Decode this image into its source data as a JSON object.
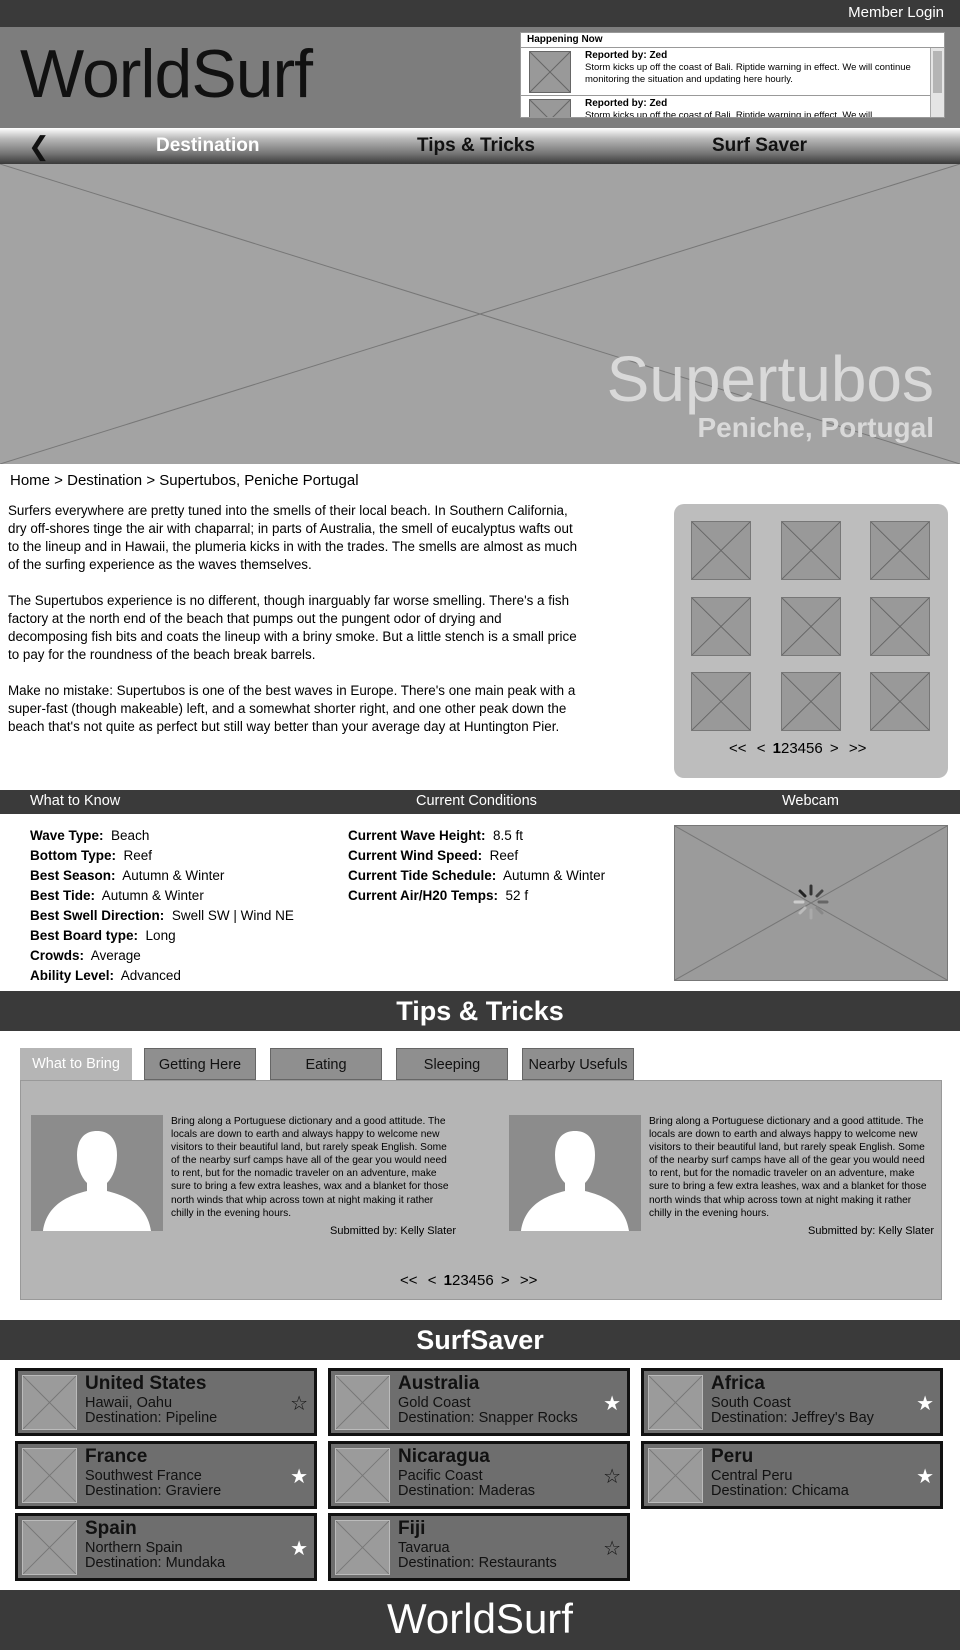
{
  "top_bar": {
    "member_login": "Member Login"
  },
  "header": {
    "logo": "WorldSurf",
    "happening_now": {
      "title": "Happening Now",
      "items": [
        {
          "reporter": "Reported by: Zed",
          "text": "Storm kicks up off the coast of Bali.  Riptide warning in effect. We will continue monitoring the situation and updating here hourly."
        },
        {
          "reporter": "Reported by: Zed",
          "text": "Storm kicks up off the coast of Bali.  Riptide warning in effect. We will"
        }
      ]
    }
  },
  "nav": {
    "back_icon": "chevron-left-icon",
    "items": [
      "Destination",
      "Tips & Tricks",
      "Surf Saver"
    ]
  },
  "hero": {
    "title": "Supertubos",
    "subtitle": "Peniche, Portugal"
  },
  "breadcrumb": "Home > Destination > Supertubos, Peniche Portugal",
  "intro": {
    "paragraphs": [
      "Surfers everywhere are pretty tuned into the smells of their local beach.  In Southern California, dry off-shores tinge the air with chaparral; in parts of Australia, the smell of eucalyptus wafts out to the lineup and in Hawaii, the plumeria kicks in with the trades. The smells are almost as much of the surfing experience as the waves themselves.",
      "The Supertubos experience is no different, though inarguably far worse smelling. There's a fish factory at the north end of the beach that pumps out the pungent odor of drying and decomposing fish bits and coats the lineup with a briny smoke. But a little stench is a small price to pay for the roundness of the beach break barrels.",
      "Make no mistake: Supertubos is one of the best waves in Europe. There's one main peak with a super-fast (though makeable) left, and a somewhat shorter right, and one other peak down the beach that's not quite as perfect but still way better than your average day at Huntington Pier."
    ]
  },
  "gallery_pager": {
    "first": "<<",
    "prev": "<",
    "pages": [
      "1",
      "2",
      "3",
      "4",
      "5",
      "6"
    ],
    "current": "1",
    "next": ">",
    "last": ">>"
  },
  "info_bar": {
    "what_to_know": "What to Know",
    "current_conditions": "Current Conditions",
    "webcam": "Webcam"
  },
  "what_to_know": [
    {
      "label": "Wave Type:",
      "value": "Beach"
    },
    {
      "label": "Bottom Type:",
      "value": "Reef"
    },
    {
      "label": "Best Season:",
      "value": "Autumn & Winter"
    },
    {
      "label": "Best Tide:",
      "value": "Autumn & Winter"
    },
    {
      "label": "Best Swell Direction:",
      "value": "Swell SW | Wind NE"
    },
    {
      "label": "Best Board type:",
      "value": "Long"
    },
    {
      "label": "Crowds:",
      "value": "Average"
    },
    {
      "label": "Ability Level:",
      "value": "Advanced"
    }
  ],
  "current_conditions": [
    {
      "label": "Current Wave Height:",
      "value": "8.5 ft"
    },
    {
      "label": "Current Wind Speed:",
      "value": "Reef"
    },
    {
      "label": "Current Tide Schedule:",
      "value": "Autumn & Winter"
    },
    {
      "label": "Current Air/H20 Temps:",
      "value": "52 f"
    }
  ],
  "tips": {
    "title": "Tips & Tricks",
    "tabs": [
      "What to Bring",
      "Getting Here",
      "Eating",
      "Sleeping",
      "Nearby Usefuls"
    ],
    "active_tab": "What to Bring",
    "entries": [
      {
        "text": "Bring along a Portuguese dictionary and a good attitude. The locals are down to earth and always happy to welcome new visitors to their beautiful land, but rarely speak English. Some of the nearby surf camps have all of the gear you would need to rent, but for the nomadic traveler on an adventure, make sure to bring a few extra leashes, wax and a blanket for those north winds that whip across town at night making it rather chilly in the evening hours.",
        "submitted_by": "Submitted by: Kelly Slater"
      },
      {
        "text": "Bring along a Portuguese dictionary and a good attitude. The locals are down to earth and always happy to welcome new visitors to their beautiful land, but rarely speak English. Some of the nearby surf camps have all of the gear you would need to rent, but for the nomadic traveler on an adventure, make sure to bring a few extra leashes, wax and a blanket for those north winds that whip across town at night making it rather chilly in the evening hours.",
        "submitted_by": "Submitted by: Kelly Slater"
      }
    ],
    "pager": {
      "first": "<<",
      "prev": "<",
      "pages": [
        "1",
        "2",
        "3",
        "4",
        "5",
        "6"
      ],
      "current": "1",
      "next": ">",
      "last": ">>"
    }
  },
  "surfsaver": {
    "title": "SurfSaver",
    "cards": [
      {
        "country": "United States",
        "region": "Hawaii, Oahu",
        "destination": "Destination: Pipeline",
        "starred": false
      },
      {
        "country": "Australia",
        "region": "Gold Coast",
        "destination": "Destination: Snapper Rocks",
        "starred": true
      },
      {
        "country": "Africa",
        "region": "South Coast",
        "destination": "Destination: Jeffrey's Bay",
        "starred": true
      },
      {
        "country": "France",
        "region": "Southwest France",
        "destination": "Destination: Graviere",
        "starred": true
      },
      {
        "country": "Nicaragua",
        "region": "Pacific Coast",
        "destination": "Destination: Maderas",
        "starred": false
      },
      {
        "country": "Peru",
        "region": "Central Peru",
        "destination": "Destination: Chicama",
        "starred": true
      },
      {
        "country": "Spain",
        "region": "Northern Spain",
        "destination": "Destination: Mundaka",
        "starred": true
      },
      {
        "country": "Fiji",
        "region": "Tavarua",
        "destination": "Destination: Restaurants",
        "starred": false
      }
    ]
  },
  "footer": {
    "logo": "WorldSurf"
  },
  "colors": {
    "dark_bar": "#3a3a3a",
    "header_gray": "#7d7d7d",
    "placeholder": "#a3a3a3"
  }
}
